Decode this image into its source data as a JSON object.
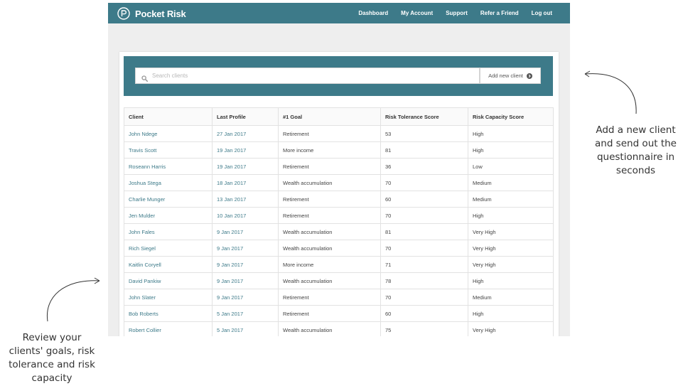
{
  "app": {
    "brand": "Pocket Risk",
    "nav": [
      "Dashboard",
      "My Account",
      "Support",
      "Refer a Friend",
      "Log out"
    ]
  },
  "search": {
    "placeholder": "Search clients",
    "icon": "search-icon"
  },
  "add_client": {
    "label": "Add new client",
    "icon": "arrow-circle-right-icon"
  },
  "table": {
    "columns": [
      "Client",
      "Last Profile",
      "#1 Goal",
      "Risk Tolerance Score",
      "Risk Capacity Score"
    ],
    "rows": [
      [
        "John Ndege",
        "27 Jan 2017",
        "Retirement",
        "53",
        "High"
      ],
      [
        "Travis Scott",
        "19 Jan 2017",
        "More income",
        "81",
        "High"
      ],
      [
        "Roseann Harris",
        "19 Jan 2017",
        "Retirement",
        "36",
        "Low"
      ],
      [
        "Joshua Stega",
        "18 Jan 2017",
        "Wealth accumulation",
        "70",
        "Medium"
      ],
      [
        "Charlie Munger",
        "13 Jan 2017",
        "Retirement",
        "60",
        "Medium"
      ],
      [
        "Jen Mulder",
        "10 Jan 2017",
        "Retirement",
        "70",
        "High"
      ],
      [
        "John Fales",
        "9 Jan 2017",
        "Wealth accumulation",
        "81",
        "Very High"
      ],
      [
        "Rich Siegel",
        "9 Jan 2017",
        "Wealth accumulation",
        "70",
        "Very High"
      ],
      [
        "Kaitlin Coryell",
        "9 Jan 2017",
        "More income",
        "71",
        "Very High"
      ],
      [
        "David Pankiw",
        "9 Jan 2017",
        "Wealth accumulation",
        "78",
        "High"
      ],
      [
        "John Slater",
        "9 Jan 2017",
        "Retirement",
        "70",
        "Medium"
      ],
      [
        "Bob Roberts",
        "5 Jan 2017",
        "Retirement",
        "60",
        "High"
      ],
      [
        "Robert Collier",
        "5 Jan 2017",
        "Wealth accumulation",
        "75",
        "Very High"
      ]
    ]
  },
  "annotations": {
    "right": [
      "Add a new client",
      "and send out the",
      "questionnaire in",
      "seconds"
    ],
    "left": [
      "Review your",
      "clients' goals, risk",
      "tolerance and risk",
      "capacity"
    ]
  },
  "colors": {
    "brand": "#3d7a89",
    "link": "#3d7a89",
    "background": "#eeeeee"
  }
}
